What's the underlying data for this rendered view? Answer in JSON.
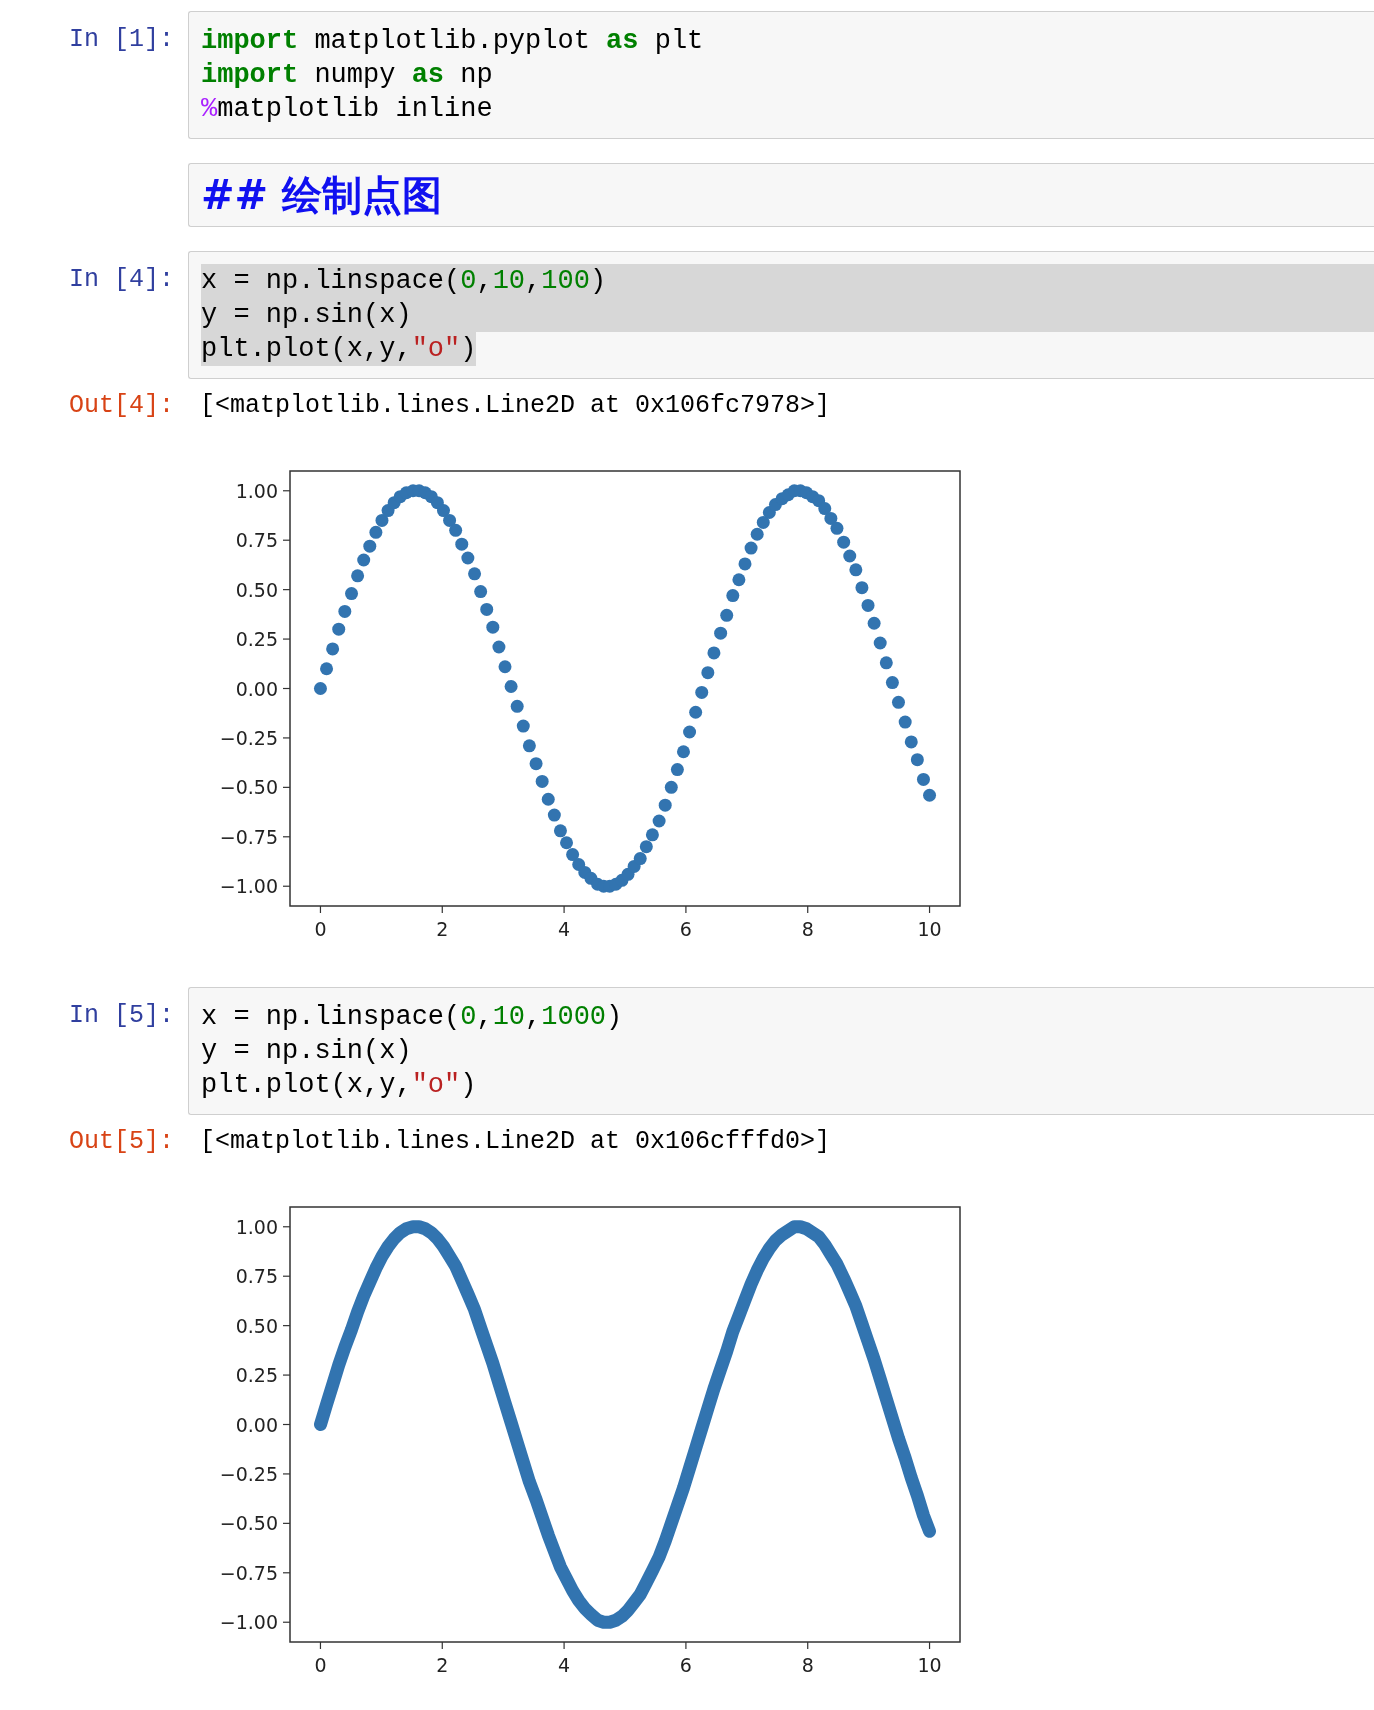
{
  "cells": [
    {
      "kind": "code",
      "prompt": "In [1]:",
      "selected_text": false,
      "lines": [
        [
          {
            "text": "import",
            "kind": "keyword"
          },
          {
            "text": " matplotlib.pyplot ",
            "kind": "plain"
          },
          {
            "text": "as",
            "kind": "keyword"
          },
          {
            "text": " plt",
            "kind": "plain"
          }
        ],
        [
          {
            "text": "import",
            "kind": "keyword"
          },
          {
            "text": " numpy ",
            "kind": "plain"
          },
          {
            "text": "as",
            "kind": "keyword"
          },
          {
            "text": " np",
            "kind": "plain"
          }
        ],
        [
          {
            "text": "%",
            "kind": "magic"
          },
          {
            "text": "matplotlib inline",
            "kind": "plain"
          }
        ]
      ]
    },
    {
      "kind": "markdown",
      "text": "## 绘制点图"
    },
    {
      "kind": "code",
      "prompt": "In [4]:",
      "selected_text": true,
      "lines": [
        [
          {
            "text": "x = np.linspace(",
            "kind": "plain"
          },
          {
            "text": "0",
            "kind": "number"
          },
          {
            "text": ",",
            "kind": "plain"
          },
          {
            "text": "10",
            "kind": "number"
          },
          {
            "text": ",",
            "kind": "plain"
          },
          {
            "text": "100",
            "kind": "number"
          },
          {
            "text": ")",
            "kind": "plain"
          }
        ],
        [
          {
            "text": "y = np.sin(x)",
            "kind": "plain"
          }
        ],
        [
          {
            "text": "plt.plot(x,y,",
            "kind": "plain"
          },
          {
            "text": "\"o\"",
            "kind": "string"
          },
          {
            "text": ")",
            "kind": "plain"
          }
        ]
      ],
      "output": {
        "prompt": "Out[4]:",
        "text": "[<matplotlib.lines.Line2D at 0x106fc7978>]",
        "chart_data": {
          "type": "scatter",
          "xlim": [
            -0.5,
            10.5
          ],
          "ylim": [
            -1.1,
            1.1
          ],
          "xticks": [
            0,
            2,
            4,
            6,
            8,
            10
          ],
          "yticks": [
            {
              "value": 1,
              "label": "1.00"
            },
            {
              "value": 0.75,
              "label": "0.75"
            },
            {
              "value": 0.5,
              "label": "0.50"
            },
            {
              "value": 0.25,
              "label": "0.25"
            },
            {
              "value": 0,
              "label": "0.00"
            },
            {
              "value": -0.25,
              "label": "−0.25"
            },
            {
              "value": -0.5,
              "label": "−0.50"
            },
            {
              "value": -0.75,
              "label": "−0.75"
            },
            {
              "value": -1,
              "label": "−1.00"
            }
          ],
          "x": [
            0.0,
            0.1,
            0.2,
            0.3,
            0.4,
            0.51,
            0.61,
            0.71,
            0.81,
            0.91,
            1.01,
            1.11,
            1.21,
            1.31,
            1.41,
            1.52,
            1.62,
            1.72,
            1.82,
            1.92,
            2.02,
            2.12,
            2.22,
            2.32,
            2.42,
            2.53,
            2.63,
            2.73,
            2.83,
            2.93,
            3.03,
            3.13,
            3.23,
            3.33,
            3.43,
            3.54,
            3.64,
            3.74,
            3.84,
            3.94,
            4.04,
            4.14,
            4.24,
            4.34,
            4.44,
            4.55,
            4.65,
            4.75,
            4.85,
            4.95,
            5.05,
            5.15,
            5.25,
            5.35,
            5.45,
            5.56,
            5.66,
            5.76,
            5.86,
            5.96,
            6.06,
            6.16,
            6.26,
            6.36,
            6.46,
            6.57,
            6.67,
            6.77,
            6.87,
            6.97,
            7.07,
            7.17,
            7.27,
            7.37,
            7.47,
            7.58,
            7.68,
            7.78,
            7.88,
            7.98,
            8.08,
            8.18,
            8.28,
            8.38,
            8.48,
            8.59,
            8.69,
            8.79,
            8.89,
            8.99,
            9.09,
            9.19,
            9.29,
            9.39,
            9.49,
            9.6,
            9.7,
            9.8,
            9.9,
            10.0
          ],
          "series": [
            {
              "color": "#3274b0",
              "values": [
                0.0,
                0.1,
                0.2,
                0.3,
                0.39,
                0.48,
                0.57,
                0.65,
                0.72,
                0.79,
                0.85,
                0.9,
                0.94,
                0.97,
                0.99,
                1.0,
                1.0,
                0.99,
                0.97,
                0.94,
                0.9,
                0.85,
                0.8,
                0.73,
                0.66,
                0.58,
                0.49,
                0.4,
                0.31,
                0.21,
                0.11,
                0.01,
                -0.09,
                -0.19,
                -0.29,
                -0.38,
                -0.47,
                -0.56,
                -0.64,
                -0.72,
                -0.78,
                -0.84,
                -0.89,
                -0.93,
                -0.96,
                -0.99,
                -1.0,
                -1.0,
                -0.99,
                -0.97,
                -0.94,
                -0.9,
                -0.86,
                -0.8,
                -0.74,
                -0.67,
                -0.59,
                -0.5,
                -0.41,
                -0.32,
                -0.22,
                -0.12,
                -0.02,
                0.08,
                0.18,
                0.28,
                0.37,
                0.47,
                0.55,
                0.63,
                0.71,
                0.78,
                0.84,
                0.89,
                0.93,
                0.96,
                0.98,
                1.0,
                1.0,
                0.99,
                0.97,
                0.95,
                0.91,
                0.86,
                0.81,
                0.74,
                0.67,
                0.6,
                0.51,
                0.42,
                0.33,
                0.23,
                0.13,
                0.03,
                -0.07,
                -0.17,
                -0.27,
                -0.36,
                -0.46,
                -0.54
              ]
            }
          ]
        }
      }
    },
    {
      "kind": "code",
      "prompt": "In [5]:",
      "selected_text": false,
      "lines": [
        [
          {
            "text": "x = np.linspace(",
            "kind": "plain"
          },
          {
            "text": "0",
            "kind": "number"
          },
          {
            "text": ",",
            "kind": "plain"
          },
          {
            "text": "10",
            "kind": "number"
          },
          {
            "text": ",",
            "kind": "plain"
          },
          {
            "text": "1000",
            "kind": "number"
          },
          {
            "text": ")",
            "kind": "plain"
          }
        ],
        [
          {
            "text": "y = np.sin(x)",
            "kind": "plain"
          }
        ],
        [
          {
            "text": "plt.plot(x,y,",
            "kind": "plain"
          },
          {
            "text": "\"o\"",
            "kind": "string"
          },
          {
            "text": ")",
            "kind": "plain"
          }
        ]
      ],
      "output": {
        "prompt": "Out[5]:",
        "text": "[<matplotlib.lines.Line2D at 0x106cfffd0>]",
        "chart_data": {
          "type": "line",
          "xlim": [
            -0.5,
            10.5
          ],
          "ylim": [
            -1.1,
            1.1
          ],
          "xticks": [
            0,
            2,
            4,
            6,
            8,
            10
          ],
          "yticks": [
            {
              "value": 1,
              "label": "1.00"
            },
            {
              "value": 0.75,
              "label": "0.75"
            },
            {
              "value": 0.5,
              "label": "0.50"
            },
            {
              "value": 0.25,
              "label": "0.25"
            },
            {
              "value": 0,
              "label": "0.00"
            },
            {
              "value": -0.25,
              "label": "−0.25"
            },
            {
              "value": -0.5,
              "label": "−0.50"
            },
            {
              "value": -0.75,
              "label": "−0.75"
            },
            {
              "value": -1,
              "label": "−1.00"
            }
          ],
          "x": [
            0.0,
            0.1,
            0.2,
            0.3,
            0.4,
            0.51,
            0.61,
            0.71,
            0.81,
            0.91,
            1.01,
            1.11,
            1.21,
            1.31,
            1.41,
            1.52,
            1.62,
            1.72,
            1.82,
            1.92,
            2.02,
            2.12,
            2.22,
            2.32,
            2.42,
            2.53,
            2.63,
            2.73,
            2.83,
            2.93,
            3.03,
            3.13,
            3.23,
            3.33,
            3.43,
            3.54,
            3.64,
            3.74,
            3.84,
            3.94,
            4.04,
            4.14,
            4.24,
            4.34,
            4.44,
            4.55,
            4.65,
            4.75,
            4.85,
            4.95,
            5.05,
            5.15,
            5.25,
            5.35,
            5.45,
            5.56,
            5.66,
            5.76,
            5.86,
            5.96,
            6.06,
            6.16,
            6.26,
            6.36,
            6.46,
            6.57,
            6.67,
            6.77,
            6.87,
            6.97,
            7.07,
            7.17,
            7.27,
            7.37,
            7.47,
            7.58,
            7.68,
            7.78,
            7.88,
            7.98,
            8.08,
            8.18,
            8.28,
            8.38,
            8.48,
            8.59,
            8.69,
            8.79,
            8.89,
            8.99,
            9.09,
            9.19,
            9.29,
            9.39,
            9.49,
            9.6,
            9.7,
            9.8,
            9.9,
            10.0
          ],
          "series": [
            {
              "color": "#3274b0",
              "values": [
                0.0,
                0.1,
                0.2,
                0.3,
                0.39,
                0.48,
                0.57,
                0.65,
                0.72,
                0.79,
                0.85,
                0.9,
                0.94,
                0.97,
                0.99,
                1.0,
                1.0,
                0.99,
                0.97,
                0.94,
                0.9,
                0.85,
                0.8,
                0.73,
                0.66,
                0.58,
                0.49,
                0.4,
                0.31,
                0.21,
                0.11,
                0.01,
                -0.09,
                -0.19,
                -0.29,
                -0.38,
                -0.47,
                -0.56,
                -0.64,
                -0.72,
                -0.78,
                -0.84,
                -0.89,
                -0.93,
                -0.96,
                -0.99,
                -1.0,
                -1.0,
                -0.99,
                -0.97,
                -0.94,
                -0.9,
                -0.86,
                -0.8,
                -0.74,
                -0.67,
                -0.59,
                -0.5,
                -0.41,
                -0.32,
                -0.22,
                -0.12,
                -0.02,
                0.08,
                0.18,
                0.28,
                0.37,
                0.47,
                0.55,
                0.63,
                0.71,
                0.78,
                0.84,
                0.89,
                0.93,
                0.96,
                0.98,
                1.0,
                1.0,
                0.99,
                0.97,
                0.95,
                0.91,
                0.86,
                0.81,
                0.74,
                0.67,
                0.6,
                0.51,
                0.42,
                0.33,
                0.23,
                0.13,
                0.03,
                -0.07,
                -0.17,
                -0.27,
                -0.36,
                -0.46,
                -0.54
              ]
            }
          ]
        }
      }
    }
  ]
}
